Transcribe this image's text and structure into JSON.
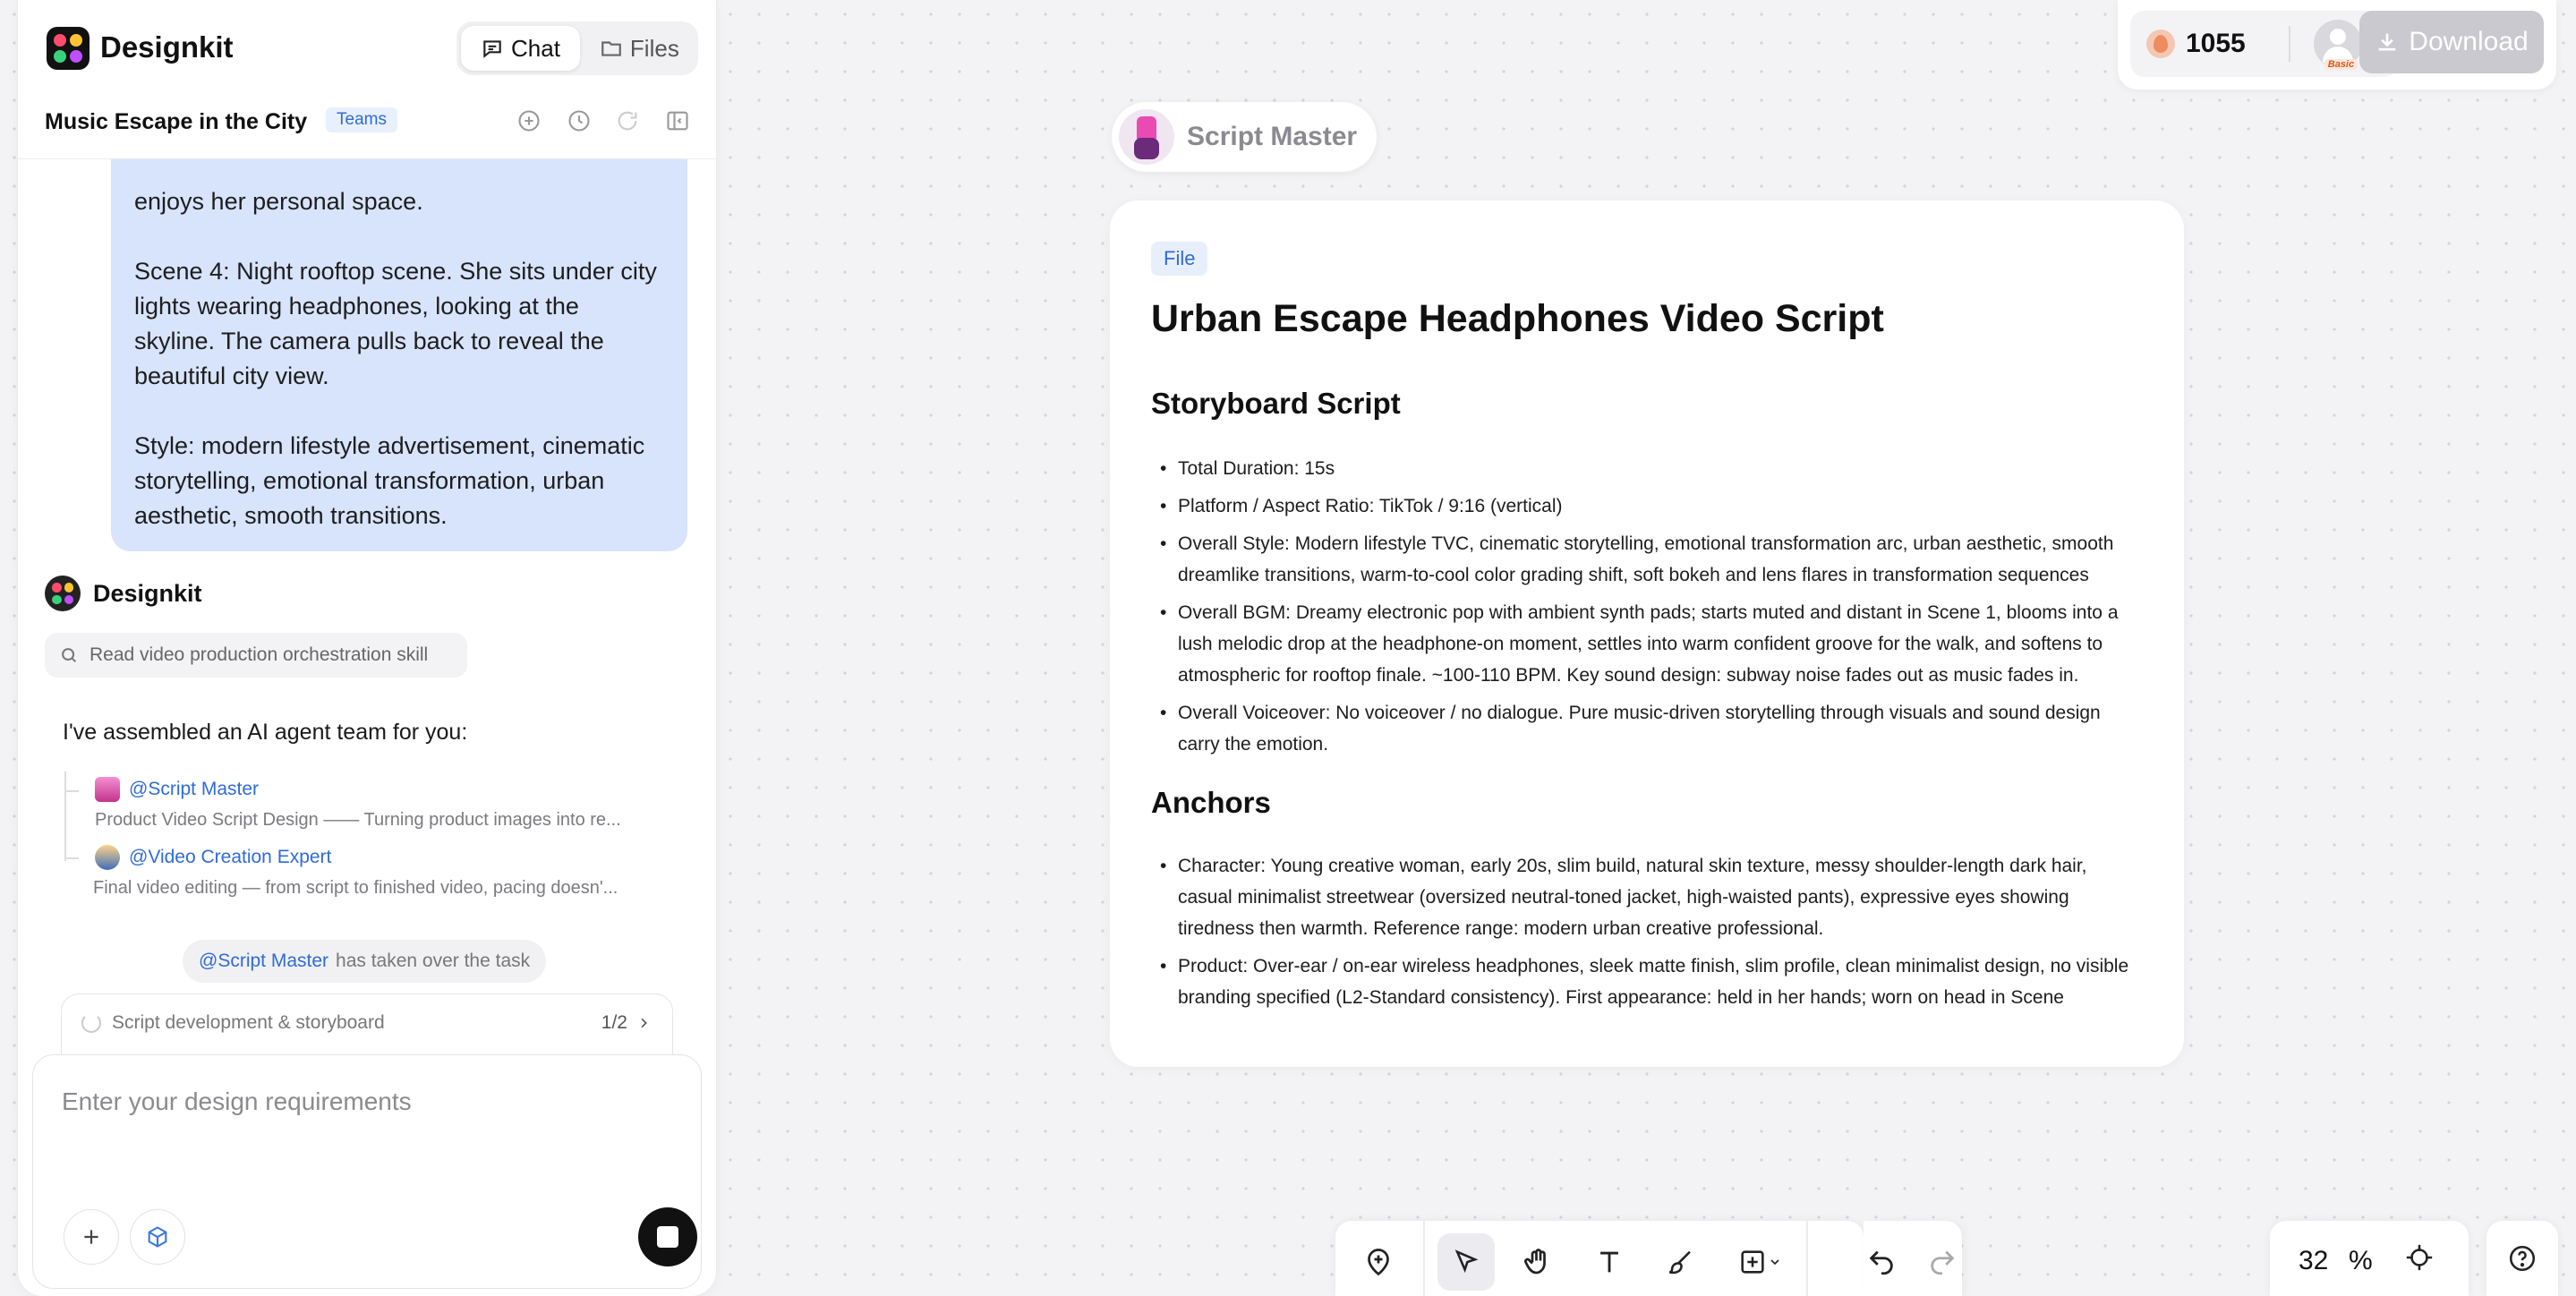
{
  "app": {
    "name": "Designkit"
  },
  "tabs": {
    "chat": "Chat",
    "files": "Files"
  },
  "project": {
    "title": "Music Escape in the City",
    "badge": "Teams"
  },
  "chat": {
    "user_message": [
      "enjoys her personal space.",
      "Scene 4: Night rooftop scene. She sits under city lights wearing headphones, looking at the skyline. The camera pulls back to reveal the beautiful city view.",
      "Style: modern lifestyle advertisement, cinematic storytelling, emotional transformation, urban aesthetic, smooth transitions."
    ],
    "bot_name": "Designkit",
    "skill_label": "Read video production orchestration skill",
    "assembled_text": "I've assembled an AI agent team for you:",
    "agents": [
      {
        "mention": "@Script Master",
        "description": "Product Video Script Design —— Turning product images into re..."
      },
      {
        "mention": "@Video Creation Expert",
        "description": "Final video editing — from script to finished video, pacing doesn'..."
      }
    ],
    "takeover": {
      "mention": "@Script Master",
      "text": "has taken over the task"
    },
    "task": {
      "label": "Script development & storyboard",
      "progress": "1/2"
    }
  },
  "input": {
    "placeholder": "Enter your design requirements"
  },
  "header_right": {
    "credits": "1055",
    "plan_badge": "Basic",
    "download_label": "Download"
  },
  "canvas": {
    "agent_chip": "Script Master",
    "doc": {
      "tag": "File",
      "title": "Urban Escape Headphones Video Script",
      "section1": "Storyboard Script",
      "items1": [
        "Total Duration: 15s",
        "Platform / Aspect Ratio: TikTok / 9:16 (vertical)",
        "Overall Style: Modern lifestyle TVC, cinematic storytelling, emotional transformation arc, urban aesthetic, smooth dreamlike transitions, warm-to-cool color grading shift, soft bokeh and lens flares in transformation sequences",
        "Overall BGM: Dreamy electronic pop with ambient synth pads; starts muted and distant in Scene 1, blooms into a lush melodic drop at the headphone-on moment, settles into warm confident groove for the walk, and softens to atmospheric for rooftop finale. ~100-110 BPM. Key sound design: subway noise fades out as music fades in.",
        "Overall Voiceover: No voiceover / no dialogue. Pure music-driven storytelling through visuals and sound design carry the emotion."
      ],
      "section2": "Anchors",
      "items2": [
        "Character: Young creative woman, early 20s, slim build, natural skin texture, messy shoulder-length dark hair, casual minimalist streetwear (oversized neutral-toned jacket, high-waisted pants), expressive eyes showing tiredness then warmth. Reference range: modern urban creative professional.",
        "Product: Over-ear / on-ear wireless headphones, sleek matte finish, slim profile, clean minimalist design, no visible branding specified (L2-Standard consistency). First appearance: held in her hands; worn on head in Scene"
      ]
    }
  },
  "zoom": {
    "value": "32",
    "unit": "%"
  },
  "colors": {
    "accent": "#2f6bd8",
    "bubble": "#d8e4fb",
    "canvas_bg": "#f3f3f5"
  }
}
